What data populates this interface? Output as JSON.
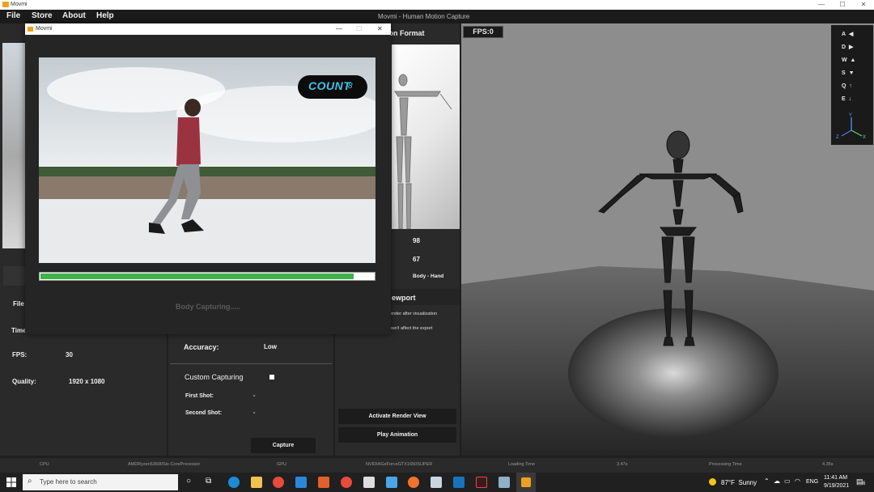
{
  "window": {
    "title": "Movmi",
    "app_title": "Movmi - Human Motion Capture",
    "controls": [
      "—",
      "☐",
      "✕"
    ]
  },
  "menu": [
    "File",
    "Store",
    "About",
    "Help"
  ],
  "left_panel": {
    "file_label": "File",
    "time_label": "Time",
    "fps_label": "FPS:",
    "fps_value": "30",
    "quality_label": "Quality:",
    "quality_value": "1920 x 1080"
  },
  "center_panel": {
    "accuracy_label": "Accuracy:",
    "accuracy_value": "Low",
    "custom_capturing_label": "Custom Capturing",
    "first_shot_label": "First Shot:",
    "first_shot_value": "-",
    "second_shot_label": "Second Shot:",
    "second_shot_value": "-",
    "capture_button": "Capture"
  },
  "right_panel": {
    "heading_partial": "ion Format",
    "value_1": "98",
    "value_2": "67",
    "value_3": "Body - Hand",
    "viewport_heading_partial": "ewport",
    "note_1": "ender after visualization",
    "note_2": "esn't affect the export",
    "activate_render_button": "Activate Render View",
    "play_animation_button": "Play Animation"
  },
  "viewport": {
    "fps_badge": "FPS:0",
    "keys": [
      {
        "key": "A",
        "arrow": "◀"
      },
      {
        "key": "D",
        "arrow": "▶"
      },
      {
        "key": "W",
        "arrow": "▲"
      },
      {
        "key": "S",
        "arrow": "▼"
      },
      {
        "key": "Q",
        "arrow": "↑"
      },
      {
        "key": "E",
        "arrow": "↓"
      }
    ],
    "gizmo_labels": {
      "y": "Y",
      "z": "Z",
      "x": "X"
    }
  },
  "dialog": {
    "title": "Movmi",
    "controls": [
      "—",
      "☐",
      "✕"
    ],
    "count_badge_text": "COUNT",
    "count_badge_value": "8",
    "status_text": "Body Capturing.....",
    "progress": 0.94
  },
  "statusbar": {
    "cpu_label": "CPU",
    "cpu_value": "AMDRyzen53600Six-CoreProcessor",
    "gpu_label": "GPU",
    "gpu_value": "NVIDIAGeForceGTX1650SUPER",
    "loading_label": "Loading Time",
    "loading_value": "3.47s",
    "processing_label": "Processing Time",
    "processing_value": "4.35s"
  },
  "taskbar": {
    "search_placeholder": "Type here to search",
    "weather": "87°F  Sunny",
    "language": "ENG",
    "time": "11:41 AM",
    "date": "9/19/2021",
    "notification_count": "6"
  },
  "colors": {
    "accent_green": "#3fb24a",
    "background_dark": "#1f1f1f",
    "panel": "#2a2a2a",
    "viewport_gray": "#8d8d8d"
  }
}
